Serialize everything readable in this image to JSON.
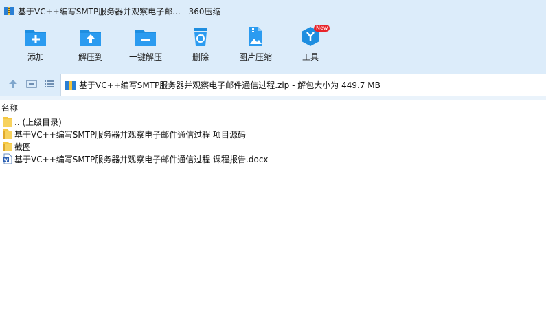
{
  "window": {
    "title": "基于VC++编写SMTP服务器并观察电子邮... - 360压缩"
  },
  "toolbar": {
    "items": [
      {
        "label": "添加",
        "icon": "add-icon"
      },
      {
        "label": "解压到",
        "icon": "extract-to-icon"
      },
      {
        "label": "一键解压",
        "icon": "one-click-extract-icon"
      },
      {
        "label": "删除",
        "icon": "delete-icon"
      },
      {
        "label": "图片压缩",
        "icon": "image-compress-icon"
      },
      {
        "label": "工具",
        "icon": "tools-icon"
      }
    ],
    "new_badge": "New"
  },
  "address": {
    "text": "基于VC++编写SMTP服务器并观察电子邮件通信过程.zip - 解包大小为 449.7 MB"
  },
  "filelist": {
    "column_name": "名称",
    "rows": [
      {
        "name": ".. (上级目录)",
        "type": "folder"
      },
      {
        "name": "基于VC++编写SMTP服务器并观察电子邮件通信过程 项目源码",
        "type": "folder-zip"
      },
      {
        "name": "截图",
        "type": "folder-zip"
      },
      {
        "name": "基于VC++编写SMTP服务器并观察电子邮件通信过程 课程报告.docx",
        "type": "docx"
      }
    ]
  },
  "colors": {
    "chrome_bg": "#dcecfa",
    "icon_blue": "#1e8ee0",
    "badge_red": "#e8242a"
  }
}
